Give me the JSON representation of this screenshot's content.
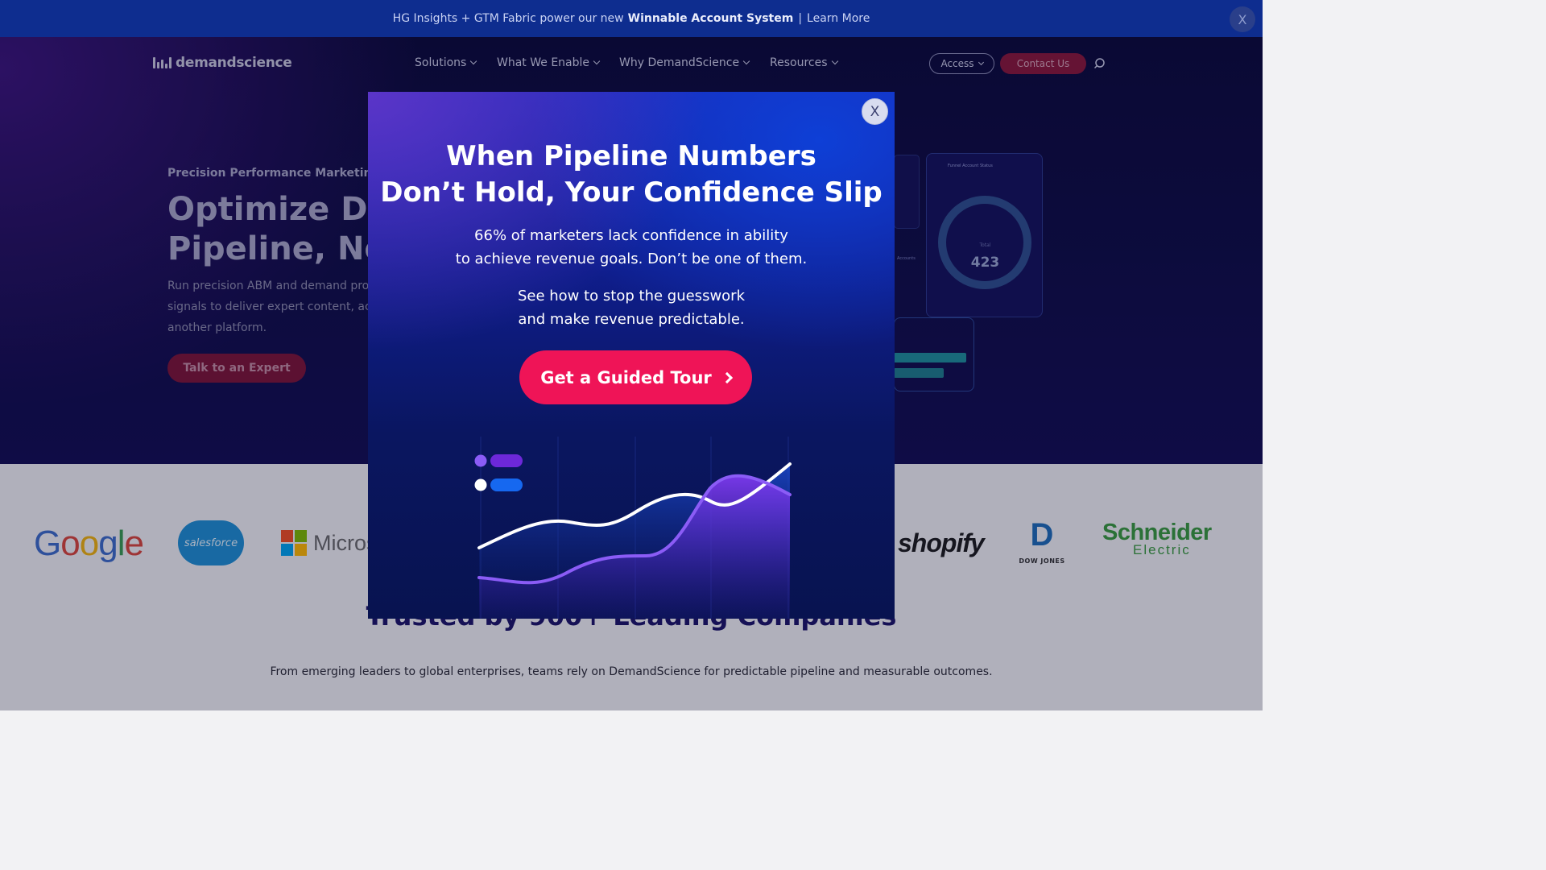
{
  "announcement": {
    "prefix": "HG Insights + GTM Fabric power our new",
    "highlight": "Winnable Account System",
    "separator": "|",
    "link": "Learn More",
    "close_label": "X"
  },
  "nav": {
    "brand": "demandscience",
    "items": [
      {
        "label": "Solutions"
      },
      {
        "label": "What We Enable"
      },
      {
        "label": "Why DemandScience"
      },
      {
        "label": "Resources"
      }
    ],
    "access_label": "Access",
    "contact_label": "Contact Us"
  },
  "hero": {
    "eyebrow": "Precision Performance Marketing a",
    "headline_line1": "Optimize De",
    "headline_line2": "Pipeline, Not",
    "subcopy_line1": "Run precision ABM and demand pro",
    "subcopy_line2": "signals to deliver expert content, ac",
    "subcopy_line3": "another platform.",
    "cta_label": "Talk to an Expert",
    "dashboard": {
      "card_title": "Funnel Account Status",
      "total_label": "Total",
      "total_value": "423",
      "accounts_label": "Accounts"
    }
  },
  "logos": {
    "google": [
      "G",
      "o",
      "o",
      "g",
      "l",
      "e"
    ],
    "salesforce": "salesforce",
    "microsoft": "Micros",
    "shopify": "shopify",
    "dowjones_mark": "D",
    "dowjones_text": "DOW JONES",
    "schneider_line1": "Schneider",
    "schneider_line2": "Electric",
    "microsoft_colors": [
      "#f25022",
      "#7fba00",
      "#00a4ef",
      "#ffb900"
    ]
  },
  "trust": {
    "heading": "Trusted by 900+ Leading Companies",
    "subtext": "From emerging leaders to global enterprises, teams rely on DemandScience for predictable pipeline and measurable outcomes."
  },
  "modal": {
    "close_label": "X",
    "title_line1": "When Pipeline Numbers",
    "title_line2": "Don’t Hold, Your Confidence Slip",
    "p1_line1": "66% of marketers lack confidence in ability",
    "p1_line2": "to achieve revenue goals. Don’t be one of them.",
    "p2_line1": "See how to stop the guesswork",
    "p2_line2": "and make revenue predictable.",
    "cta_label": "Get a Guided Tour",
    "colors": {
      "cta": "#ef1457",
      "series_white": "#ffffff",
      "series_purple": "#8b5cf6",
      "legend_blue": "#1668f0"
    }
  }
}
